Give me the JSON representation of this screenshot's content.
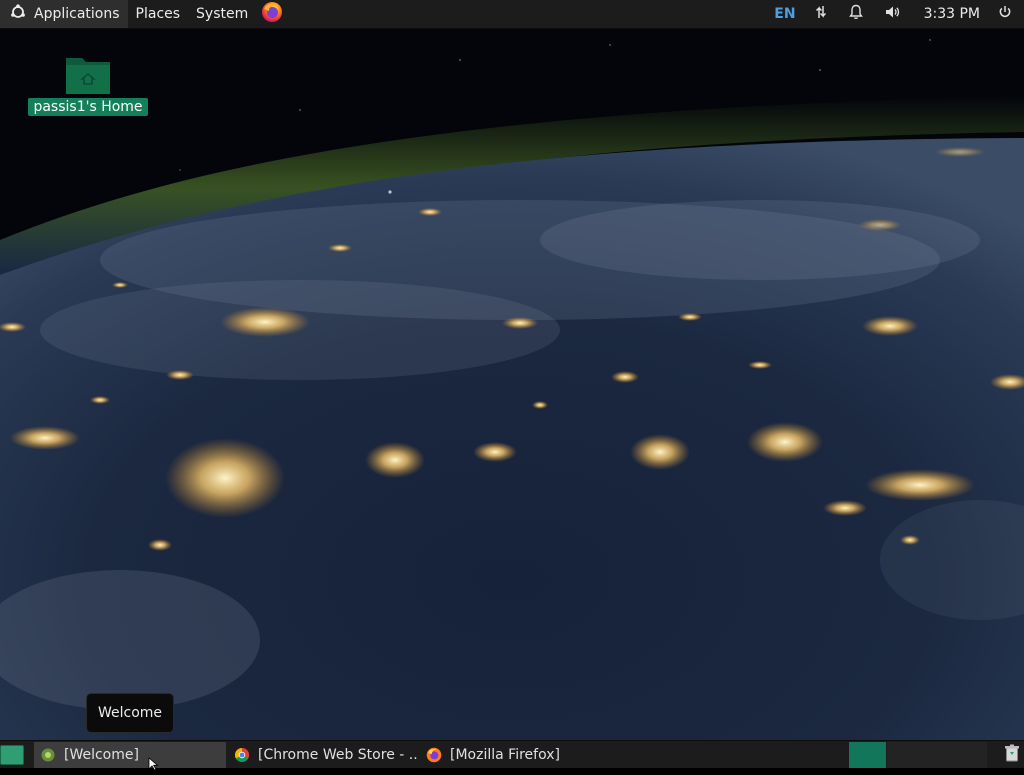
{
  "top_panel": {
    "menus": {
      "applications": "Applications",
      "places": "Places",
      "system": "System"
    },
    "tray": {
      "language": "EN",
      "clock": "3:33 PM"
    }
  },
  "desktop": {
    "icons": [
      {
        "label": "passis1's Home",
        "icon": "home-folder-icon"
      }
    ]
  },
  "tooltip": {
    "text": "Welcome"
  },
  "taskbar": {
    "tasks": [
      {
        "label": "[Welcome]",
        "icon": "welcome-app-icon",
        "active": true
      },
      {
        "label": "[Chrome Web Store - ...",
        "icon": "chrome-icon",
        "active": false
      },
      {
        "label": "[Mozilla Firefox]",
        "icon": "firefox-icon",
        "active": false
      }
    ]
  },
  "colors": {
    "panel_bg": "#1c1c1c",
    "accent_green": "#13805a",
    "language_blue": "#4c9fe0"
  }
}
